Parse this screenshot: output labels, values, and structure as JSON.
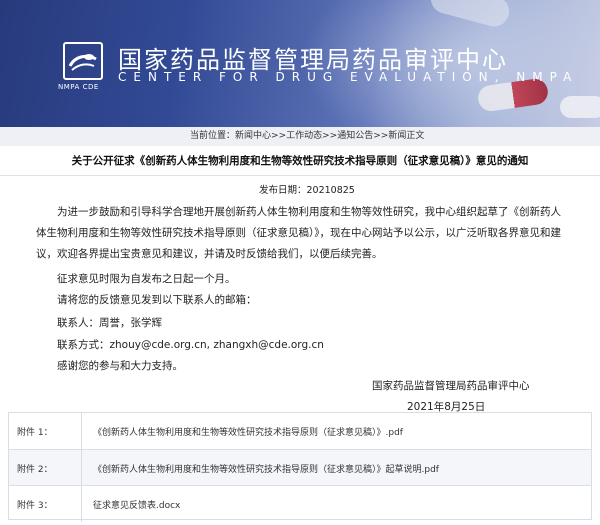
{
  "header": {
    "title_cn": "国家药品监督管理局药品审评中心",
    "title_en": "CENTER FOR DRUG EVALUATION, NMPA",
    "logo_caption": "NMPA CDE"
  },
  "breadcrumb": {
    "prefix": "当前位置：",
    "items": [
      "新闻中心",
      "工作动态",
      "通知公告",
      "新闻正文"
    ],
    "separator": ">>"
  },
  "article": {
    "title": "关于公开征求《创新药人体生物利用度和生物等效性研究技术指导原则（征求意见稿）》意见的通知",
    "pub_date": "发布日期：20210825",
    "paragraph": "为进一步鼓励和引导科学合理地开展创新药人体生物利用度和生物等效性研究，我中心组织起草了《创新药人体生物利用度和生物等效性研究技术指导原则（征求意见稿）》，现在中心网站予以公示，以广泛听取各界意见和建议，欢迎各界提出宝贵意见和建议，并请及时反馈给我们，以便后续完善。",
    "deadline": "征求意见时限为自发布之日起一个月。",
    "email_intro": "请将您的反馈意见发到以下联系人的邮箱：",
    "contacts": "联系人：周誉，张学辉",
    "contact_method": "联系方式：zhouy@cde.org.cn, zhangxh@cde.org.cn",
    "thanks": "感谢您的参与和大力支持。",
    "signature_org": "国家药品监督管理局药品审评中心",
    "signature_date": "2021年8月25日"
  },
  "attachments": [
    {
      "label": "附件 1：",
      "name": "《创新药人体生物利用度和生物等效性研究技术指导原则（征求意见稿）》.pdf"
    },
    {
      "label": "附件 2：",
      "name": "《创新药人体生物利用度和生物等效性研究技术指导原则（征求意见稿）》起草说明.pdf"
    },
    {
      "label": "附件 3：",
      "name": "征求意见反馈表.docx"
    }
  ],
  "colors": {
    "banner_dark": "#283a7c",
    "banner_light": "#c7cde3",
    "breadcrumb_bg": "#eef0f6",
    "table_border": "#d9dde6"
  }
}
